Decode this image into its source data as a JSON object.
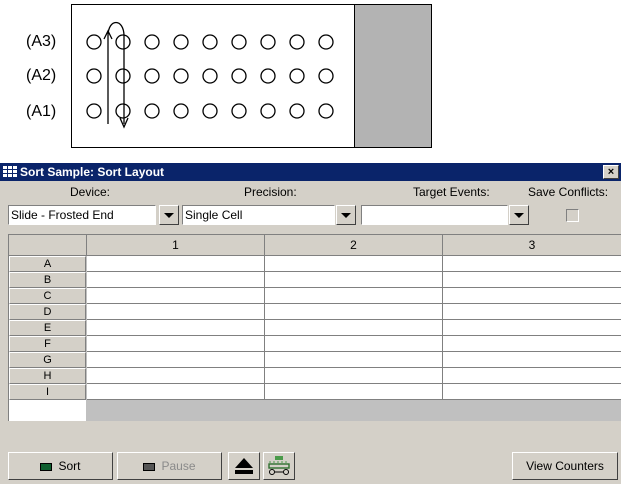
{
  "diagram": {
    "row_labels": [
      "(A3)",
      "(A2)",
      "(A1)"
    ]
  },
  "window": {
    "title": "Sort Sample: Sort Layout",
    "close_glyph": "×",
    "title_icon": "grid-icon",
    "headers": {
      "device": "Device:",
      "precision": "Precision:",
      "target_events": "Target Events:",
      "save_conflicts": "Save Conflicts:"
    },
    "fields": {
      "device_value": "Slide - Frosted End",
      "precision_value": "Single Cell",
      "target_events_value": ""
    },
    "grid": {
      "columns": [
        "1",
        "2",
        "3"
      ],
      "rows": [
        "A",
        "B",
        "C",
        "D",
        "E",
        "F",
        "G",
        "H",
        "I"
      ]
    },
    "buttons": {
      "sort": "Sort",
      "pause": "Pause",
      "eject_icon": "eject-icon",
      "tray_icon": "tray-icon",
      "view_counters": "View Counters"
    }
  },
  "colors": {
    "titlebar": "#0a246a",
    "window_bg": "#d4d0c8",
    "frosted_end": "#b3b3b3"
  }
}
